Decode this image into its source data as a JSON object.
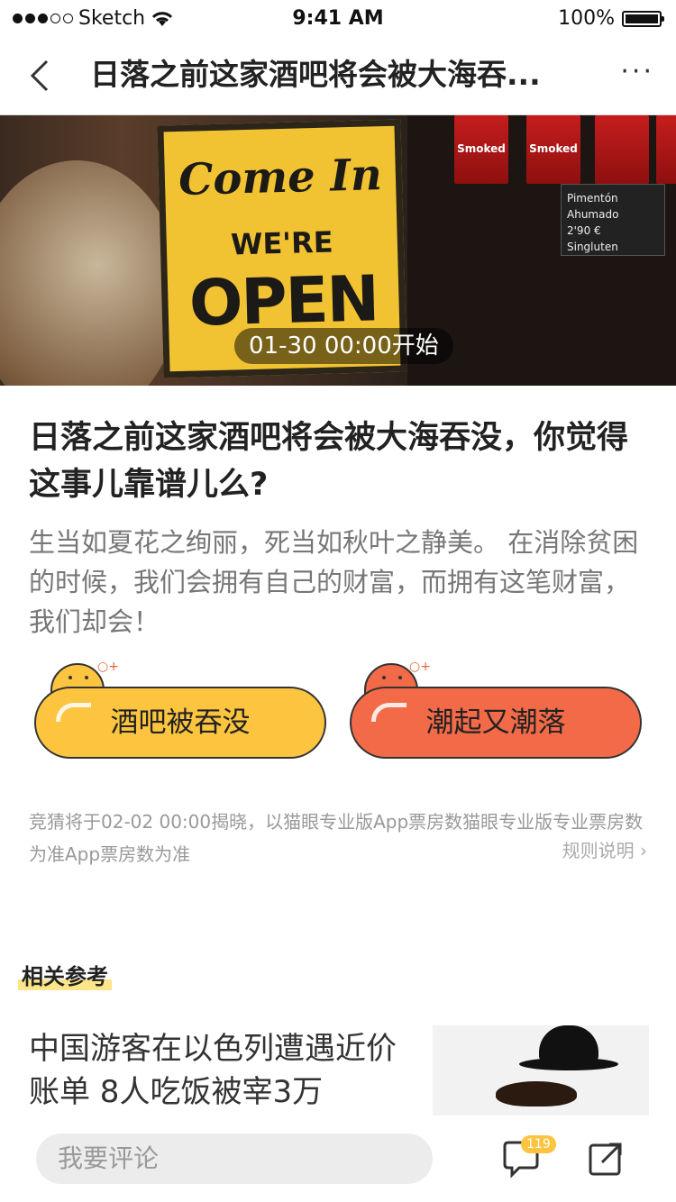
{
  "status_bar": {
    "carrier": "Sketch",
    "time": "9:41 AM",
    "battery": "100%"
  },
  "nav": {
    "title": "日落之前这家酒吧将会被大海吞...",
    "more": "···"
  },
  "hero": {
    "start_time": "01-30 00:00开始",
    "sign_line1": "Come In",
    "sign_line2": "WE'RE",
    "sign_line3": "OPEN",
    "tin_label": "Smoked",
    "chalk_lines": [
      "Pimentón",
      "Ahumado",
      "2'90 €",
      "Singluten"
    ]
  },
  "post": {
    "headline": "日落之前这家酒吧将会被大海吞没，你觉得这事儿靠谱儿么?",
    "description": "生当如夏花之绚丽，死当如秋叶之静美。 在消除贫困的时候，我们会拥有自己的财富，而拥有这笔财富，我们却会！"
  },
  "vote": {
    "option_yes": "酒吧被吞没",
    "option_no": "潮起又潮落"
  },
  "rules": {
    "note": "竞猜将于02-02 00:00揭晓，以猫眼专业版App票房数猫眼专业版专业票房数为准App票房数为准",
    "link": "规则说明 ›"
  },
  "related": {
    "section_title": "相关参考",
    "article_title": "中国游客在以色列遭遇近价账单 8人吃饭被宰3万"
  },
  "bottom": {
    "comment_placeholder": "我要评论",
    "comment_count": "119"
  },
  "colors": {
    "accent_yellow": "#fcc43f",
    "accent_red": "#f26a48",
    "highlight": "#fde68a"
  }
}
